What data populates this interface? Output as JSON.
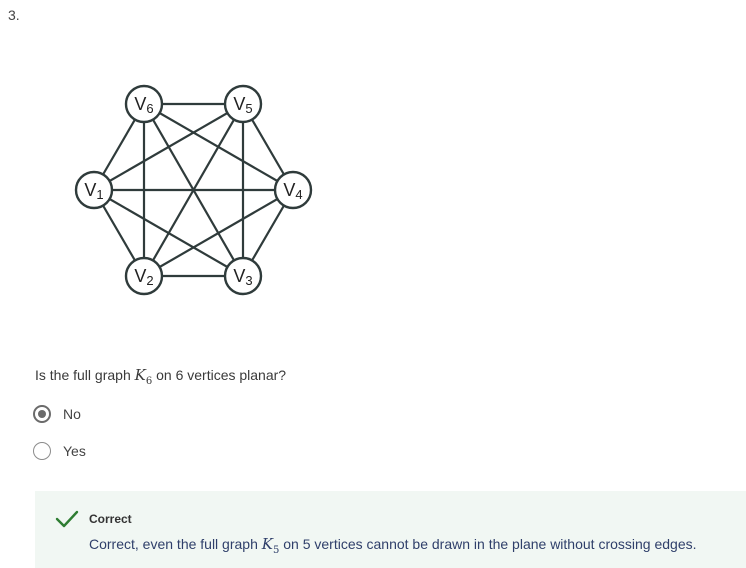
{
  "question_number": "3.",
  "graph": {
    "vertices": [
      {
        "id": "v1",
        "base": "V",
        "sub": "1"
      },
      {
        "id": "v2",
        "base": "V",
        "sub": "2"
      },
      {
        "id": "v3",
        "base": "V",
        "sub": "3"
      },
      {
        "id": "v4",
        "base": "V",
        "sub": "4"
      },
      {
        "id": "v5",
        "base": "V",
        "sub": "5"
      },
      {
        "id": "v6",
        "base": "V",
        "sub": "6"
      }
    ],
    "edge_color": "#2f3b3b"
  },
  "question": {
    "prefix": "Is the full graph ",
    "math_base": "K",
    "math_sub": "6",
    "suffix": " on 6 vertices planar?"
  },
  "options": [
    {
      "label": "No",
      "selected": true
    },
    {
      "label": "Yes",
      "selected": false
    }
  ],
  "feedback": {
    "title": "Correct",
    "prefix": "Correct, even the full graph ",
    "math_base": "K",
    "math_sub": "5",
    "suffix": " on 5 vertices cannot be drawn in the plane without crossing edges.",
    "check_color": "#2e7d32",
    "background": "#f1f7f3"
  }
}
